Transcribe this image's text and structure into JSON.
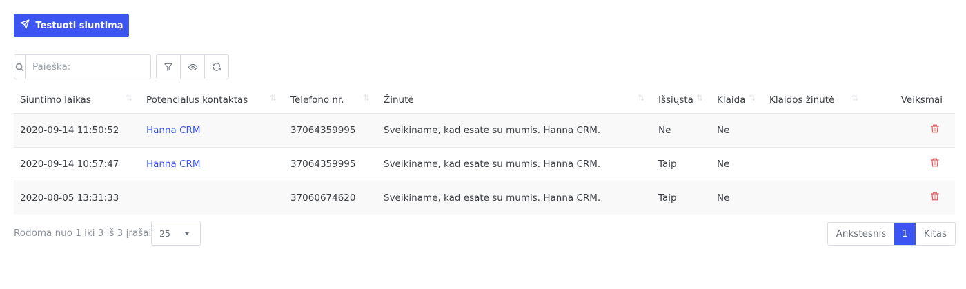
{
  "toolbar": {
    "test_button_label": "Testuoti siuntimą"
  },
  "search": {
    "placeholder": "Paieška:"
  },
  "tools": {
    "icons": [
      "filter-icon",
      "eye-icon",
      "refresh-icon"
    ]
  },
  "table": {
    "headers": {
      "time": "Siuntimo laikas",
      "contact": "Potencialus kontaktas",
      "phone": "Telefono nr.",
      "message": "Žinutė",
      "sent": "Išsiųsta",
      "error": "Klaida",
      "error_message": "Klaidos žinutė",
      "actions": "Veiksmai"
    },
    "rows": [
      {
        "time": "2020-09-14 11:50:52",
        "contact": "Hanna CRM",
        "phone": "37064359995",
        "message": "Sveikiname, kad esate su mumis. Hanna CRM.",
        "sent": "Ne",
        "error": "Ne",
        "error_message": ""
      },
      {
        "time": "2020-09-14 10:57:47",
        "contact": "Hanna CRM",
        "phone": "37064359995",
        "message": "Sveikiname, kad esate su mumis. Hanna CRM.",
        "sent": "Taip",
        "error": "Ne",
        "error_message": ""
      },
      {
        "time": "2020-08-05 13:31:33",
        "contact": "",
        "phone": "37060674620",
        "message": "Sveikiname, kad esate su mumis. Hanna CRM.",
        "sent": "Taip",
        "error": "Ne",
        "error_message": ""
      }
    ]
  },
  "footer": {
    "info": "Rodoma nuo 1 iki 3 iš 3 įrašai",
    "page_size": "25",
    "pager": {
      "prev": "Ankstesnis",
      "current": "1",
      "next": "Kitas"
    }
  },
  "colors": {
    "accent": "#3c55f0",
    "danger": "#e05a5a"
  }
}
